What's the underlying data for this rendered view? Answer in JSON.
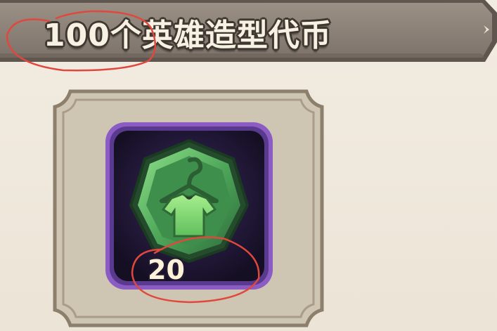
{
  "banner": {
    "title": "100个英雄造型代币"
  },
  "item": {
    "icon": "outfit-token-hanger-shirt-icon",
    "quantity": "20"
  },
  "colors": {
    "banner_fill": "#8c8278",
    "banner_edge": "#6b625a",
    "title_text": "#f7f1e4",
    "frame_fill": "#c9bfae",
    "frame_edge": "#8f8370",
    "slot_purple": "#7a4fb0",
    "slot_dark": "#1d1530",
    "token_green": "#5fb86a",
    "annotation_red": "#e0483e"
  }
}
